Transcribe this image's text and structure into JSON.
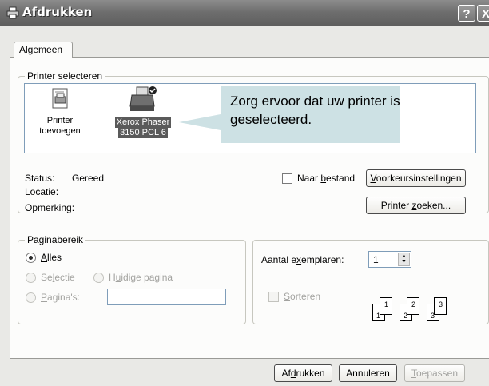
{
  "window": {
    "title": "Afdrukken",
    "help": "?",
    "close": "X"
  },
  "tabs": [
    {
      "label": "Algemeen"
    }
  ],
  "printer_group": {
    "legend": "Printer selecteren",
    "items": [
      {
        "label_line1": "Printer",
        "label_line2": "toevoegen"
      },
      {
        "label_line1": "Xerox Phaser",
        "label_line2": "3150 PCL 6"
      }
    ],
    "callout": "Zorg ervoor dat uw printer is geselecteerd.",
    "status_label": "Status:",
    "status_value": "Gereed",
    "location_label": "Locatie:",
    "comment_label": "Opmerking:",
    "print_to_file": {
      "pre": "Naar ",
      "key": "b",
      "post": "estand"
    },
    "preferences_button": {
      "key": "V",
      "post": "oorkeursinstellingen"
    },
    "find_printer_button": {
      "pre": "Printer ",
      "key": "z",
      "post": "oeken..."
    }
  },
  "range_group": {
    "legend": "Paginabereik",
    "all": {
      "key": "A",
      "post": "lles"
    },
    "selection": {
      "pre": "Se",
      "key": "l",
      "post": "ectie"
    },
    "current": {
      "pre": "H",
      "key": "u",
      "post": "idige pagina"
    },
    "pages": {
      "key": "P",
      "post": "agina's:"
    }
  },
  "copies": {
    "label_pre": "Aantal e",
    "label_key": "x",
    "label_post": "emplaren:",
    "value": "1",
    "collate": {
      "key": "S",
      "post": "orteren"
    },
    "pages_icons": [
      "1",
      "1",
      "2",
      "2",
      "3",
      "3"
    ]
  },
  "buttons": {
    "print": {
      "pre": "Af",
      "key": "d",
      "post": "rukken"
    },
    "cancel": "Annuleren",
    "apply": {
      "key": "T",
      "post": "oepassen"
    }
  }
}
